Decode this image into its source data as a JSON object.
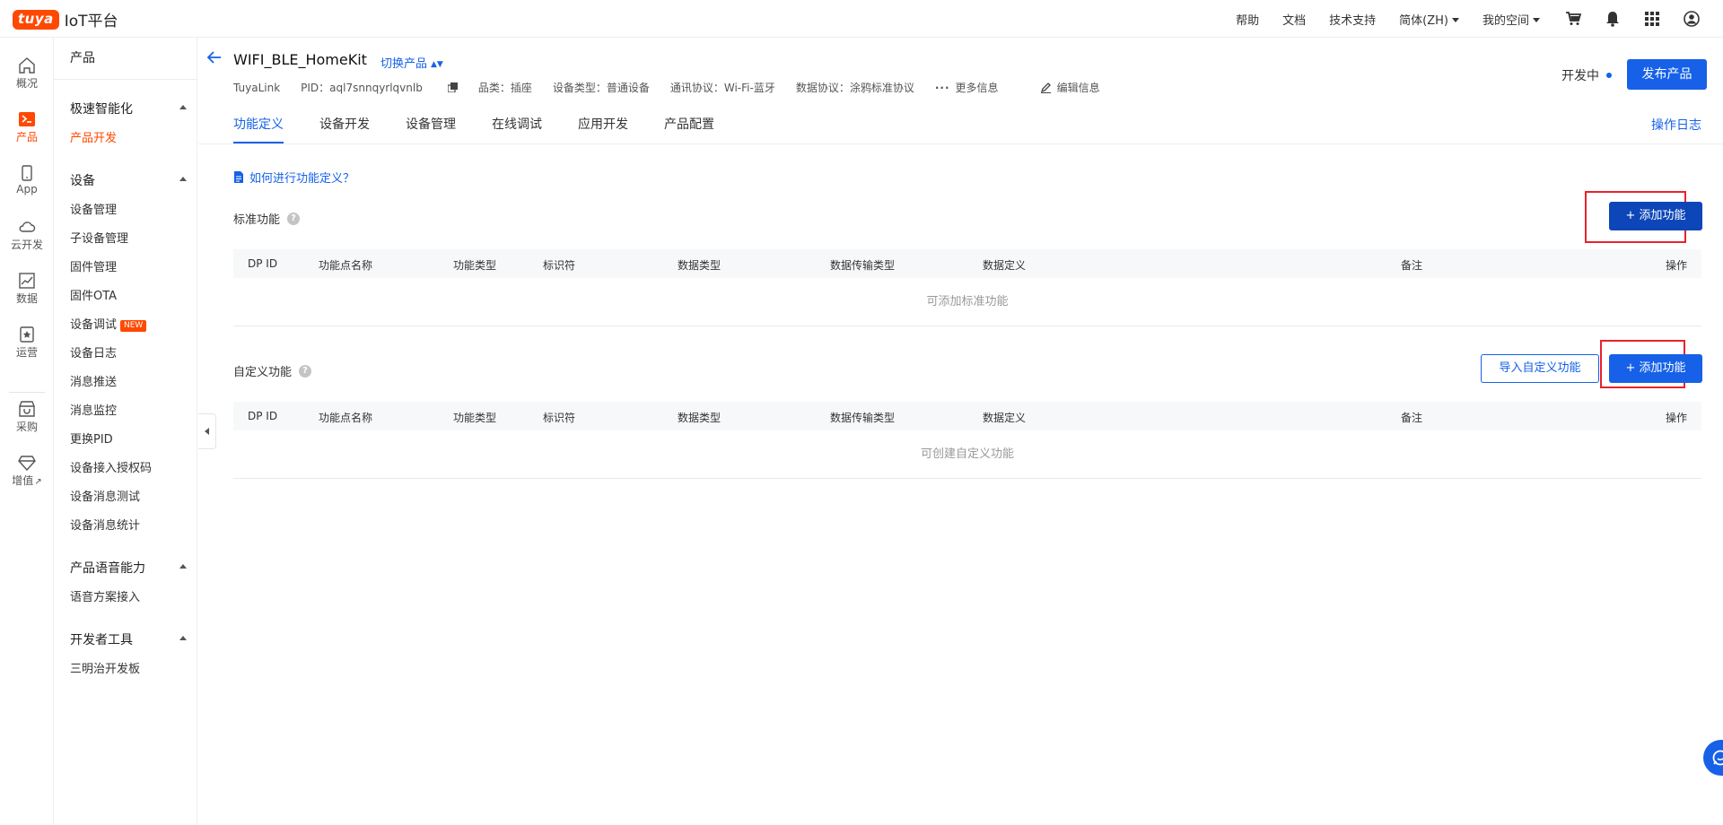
{
  "topbar": {
    "logo_brand": "tuya",
    "logo_name": "IoT平台",
    "nav": [
      "帮助",
      "文档",
      "技术支持"
    ],
    "lang": "简体(ZH)",
    "space": "我的空间",
    "icons": [
      "cart-icon",
      "bell-icon",
      "apps-grid-icon",
      "user-icon"
    ]
  },
  "rail": [
    {
      "label": "概况",
      "icon": "home-icon"
    },
    {
      "label": "产品",
      "icon": "terminal-icon"
    },
    {
      "label": "App",
      "icon": "phone-icon"
    },
    {
      "label": "云开发",
      "icon": "cloud-icon"
    },
    {
      "label": "数据",
      "icon": "chart-icon"
    },
    {
      "label": "运营",
      "icon": "star-badge-icon"
    },
    {
      "label": "采购",
      "icon": "shop-icon"
    },
    {
      "label": "增值",
      "icon": "diamond-icon"
    }
  ],
  "sidebar": {
    "header": "产品",
    "groups": [
      {
        "title": "极速智能化",
        "items": [
          "产品开发"
        ]
      },
      {
        "title": "设备",
        "items": [
          "设备管理",
          "子设备管理",
          "固件管理",
          "固件OTA",
          "设备调试",
          "设备日志",
          "消息推送",
          "消息监控",
          "更换PID",
          "设备接入授权码",
          "设备消息测试",
          "设备消息统计"
        ]
      },
      {
        "title": "产品语音能力",
        "items": [
          "语音方案接入"
        ]
      },
      {
        "title": "开发者工具",
        "items": [
          "三明治开发板"
        ]
      }
    ],
    "new_badge": "NEW"
  },
  "product": {
    "title": "WIFI_BLE_HomeKit",
    "switch_label": "切换产品",
    "meta": {
      "link": "TuyaLink",
      "pid": "PID：aql7snnqyrlqvnlb",
      "category": "品类：插座",
      "device_type": "设备类型：普通设备",
      "comm": "通讯协议：Wi-Fi-蓝牙",
      "data_protocol": "数据协议：涂鸦标准协议",
      "more": "更多信息",
      "edit": "编辑信息"
    },
    "status": "开发中",
    "publish": "发布产品"
  },
  "tabs": [
    "功能定义",
    "设备开发",
    "设备管理",
    "在线调试",
    "应用开发",
    "产品配置"
  ],
  "active_tab": "功能定义",
  "op_log": "操作日志",
  "howto": "如何进行功能定义？",
  "standard": {
    "title": "标准功能",
    "add_button": "+ 添加功能",
    "empty": "可添加标准功能"
  },
  "custom": {
    "title": "自定义功能",
    "import_button": "导入自定义功能",
    "add_button": "+ 添加功能",
    "empty": "可创建自定义功能"
  },
  "columns": [
    "DP ID",
    "功能点名称",
    "功能类型",
    "标识符",
    "数据类型",
    "数据传输类型",
    "数据定义",
    "备注",
    "操作"
  ],
  "colors": {
    "accent": "#1661e8",
    "brand": "#ff4800",
    "highlight": "#e8222d"
  }
}
